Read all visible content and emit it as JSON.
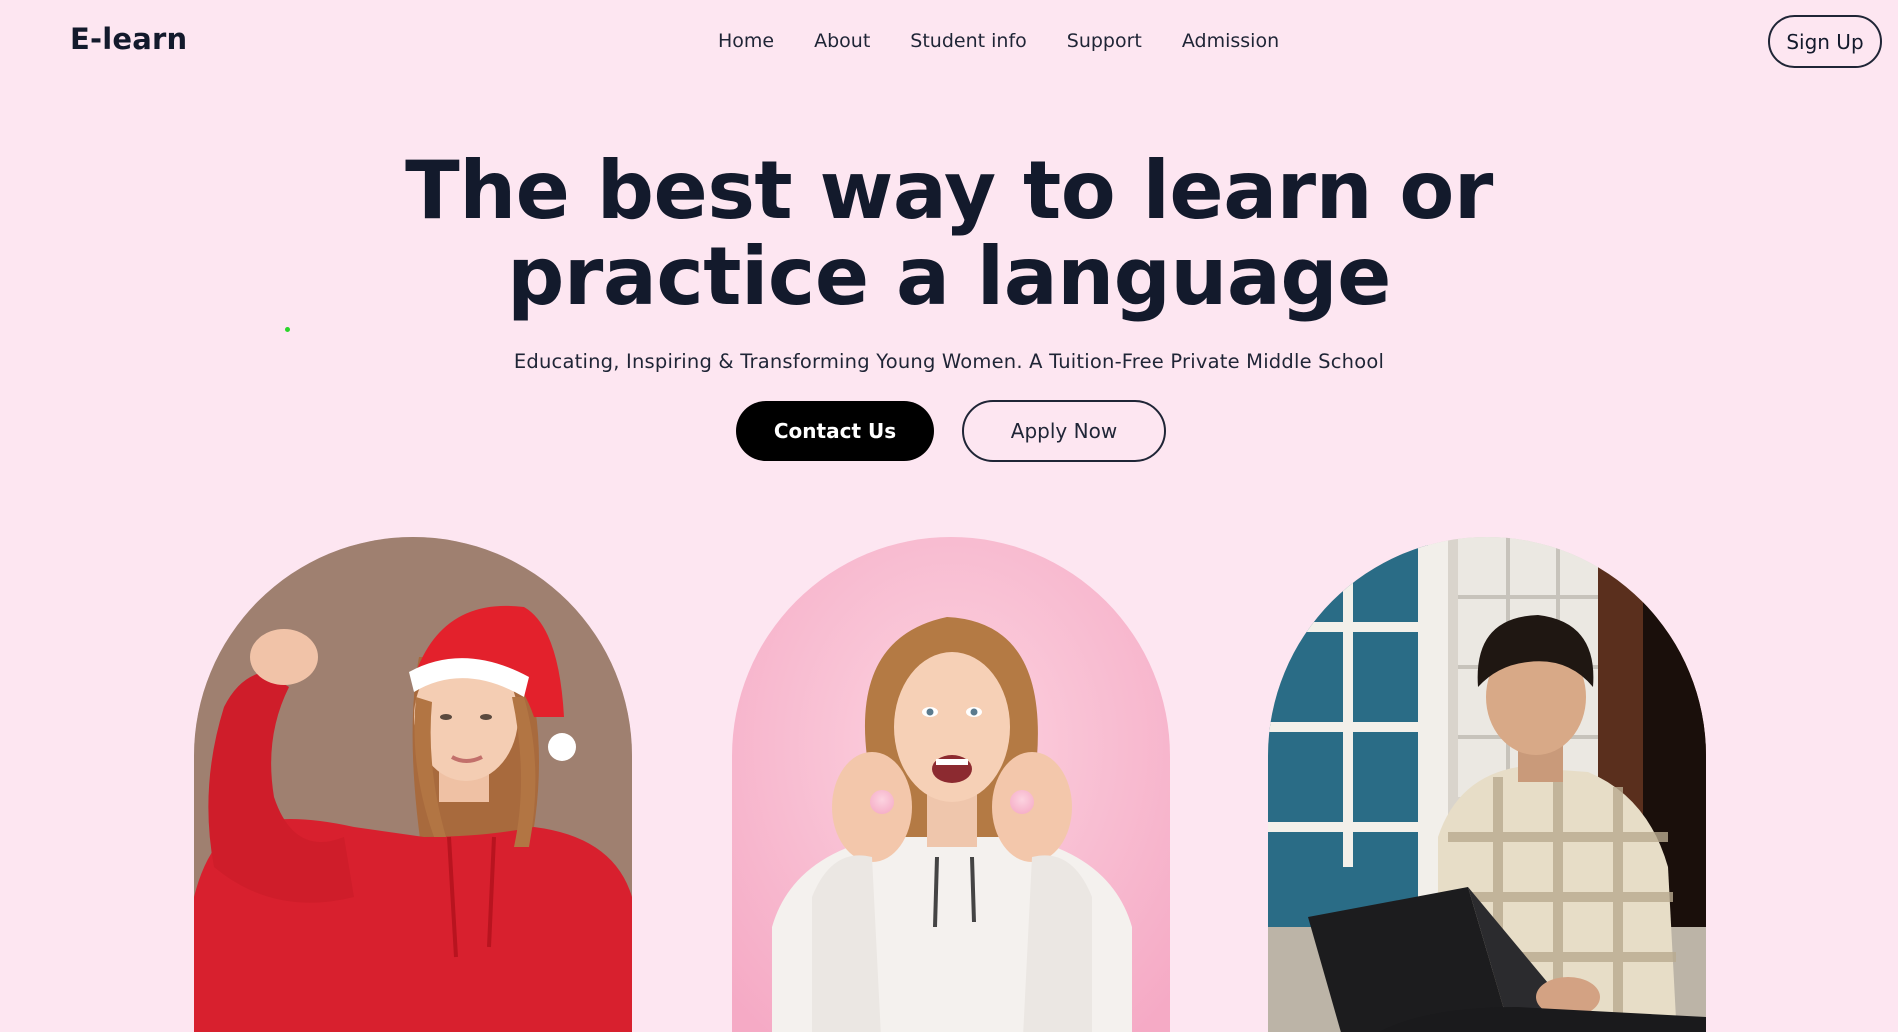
{
  "brand": {
    "logo_text": "E-learn"
  },
  "nav": {
    "items": [
      {
        "label": "Home"
      },
      {
        "label": "About"
      },
      {
        "label": "Student info"
      },
      {
        "label": "Support"
      },
      {
        "label": "Admission"
      }
    ],
    "signup_label": "Sign Up"
  },
  "hero": {
    "title_line1": "The best way to learn or",
    "title_line2": "practice a language",
    "subtitle": "Educating, Inspiring & Transforming Young Women. A Tuition-Free Private Middle School",
    "contact_label": "Contact Us",
    "apply_label": "Apply Now"
  },
  "colors": {
    "background": "#fde6f1",
    "text": "#131a2c",
    "primary_button": "#000000"
  }
}
